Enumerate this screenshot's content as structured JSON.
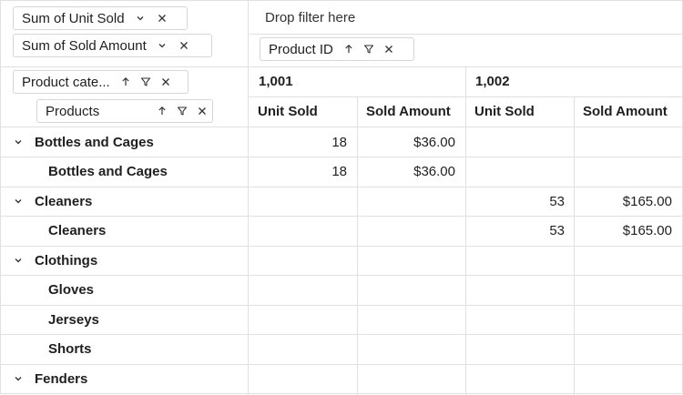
{
  "filter_area": {
    "value_chips": [
      {
        "label": "Sum of Unit Sold"
      },
      {
        "label": "Sum of Sold Amount"
      }
    ],
    "drop_placeholder": "Drop filter here"
  },
  "column_area": {
    "chip": {
      "label": "Product ID"
    }
  },
  "row_area": {
    "chips": [
      {
        "label": "Product cate..."
      },
      {
        "label": "Products"
      }
    ]
  },
  "grid": {
    "column_groups": [
      "1,001",
      "1,002"
    ],
    "value_headers": [
      "Unit Sold",
      "Sold Amount",
      "Unit Sold",
      "Sold Amount"
    ],
    "rows": [
      {
        "label": "Bottles and Cages",
        "level": 0,
        "expanded": true,
        "cells": [
          "18",
          "$36.00",
          "",
          ""
        ]
      },
      {
        "label": "Bottles and Cages",
        "level": 1,
        "cells": [
          "18",
          "$36.00",
          "",
          ""
        ]
      },
      {
        "label": "Cleaners",
        "level": 0,
        "expanded": true,
        "cells": [
          "",
          "",
          "53",
          "$165.00"
        ]
      },
      {
        "label": "Cleaners",
        "level": 1,
        "cells": [
          "",
          "",
          "53",
          "$165.00"
        ]
      },
      {
        "label": "Clothings",
        "level": 0,
        "expanded": true,
        "cells": [
          "",
          "",
          "",
          ""
        ]
      },
      {
        "label": "Gloves",
        "level": 1,
        "cells": [
          "",
          "",
          "",
          ""
        ]
      },
      {
        "label": "Jerseys",
        "level": 1,
        "cells": [
          "",
          "",
          "",
          ""
        ]
      },
      {
        "label": "Shorts",
        "level": 1,
        "cells": [
          "",
          "",
          "",
          ""
        ]
      },
      {
        "label": "Fenders",
        "level": 0,
        "expanded": true,
        "cells": [
          "",
          "",
          "",
          ""
        ]
      }
    ]
  }
}
